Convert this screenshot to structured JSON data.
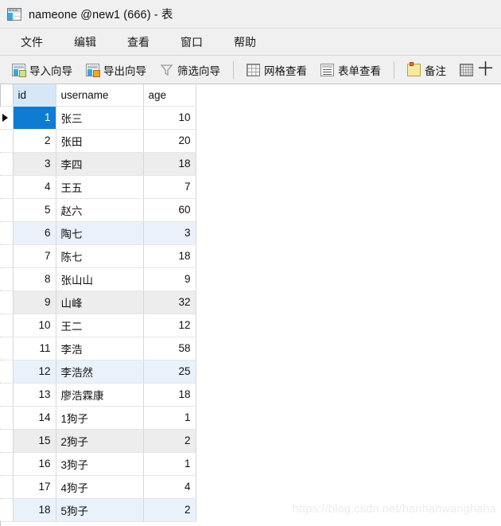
{
  "window": {
    "title": "nameone @new1 (666) - 表",
    "icon": "table-icon"
  },
  "menubar": {
    "items": [
      {
        "label": "文件",
        "name": "menu-file"
      },
      {
        "label": "编辑",
        "name": "menu-edit"
      },
      {
        "label": "查看",
        "name": "menu-view"
      },
      {
        "label": "窗口",
        "name": "menu-window"
      },
      {
        "label": "帮助",
        "name": "menu-help"
      }
    ]
  },
  "toolbar": {
    "groups": [
      {
        "buttons": [
          {
            "label": "导入向导",
            "icon": "import-wizard-icon"
          },
          {
            "label": "导出向导",
            "icon": "export-wizard-icon"
          },
          {
            "label": "筛选向导",
            "icon": "filter-wizard-icon"
          }
        ]
      },
      {
        "buttons": [
          {
            "label": "网格查看",
            "icon": "grid-view-icon"
          },
          {
            "label": "表单查看",
            "icon": "form-view-icon"
          }
        ]
      },
      {
        "buttons": [
          {
            "label": "备注",
            "icon": "memo-icon"
          },
          {
            "label": "十",
            "icon": "add-record-icon"
          }
        ]
      }
    ]
  },
  "grid": {
    "columns": [
      "id",
      "username",
      "age"
    ],
    "selected_cell": {
      "row": 1,
      "column": "id"
    },
    "rows": [
      {
        "id": "1",
        "username": "张三",
        "age": "10"
      },
      {
        "id": "2",
        "username": "张田",
        "age": "20"
      },
      {
        "id": "3",
        "username": "李四",
        "age": "18"
      },
      {
        "id": "4",
        "username": "王五",
        "age": "7"
      },
      {
        "id": "5",
        "username": "赵六",
        "age": "60"
      },
      {
        "id": "6",
        "username": "陶七",
        "age": "3"
      },
      {
        "id": "7",
        "username": "陈七",
        "age": "18"
      },
      {
        "id": "8",
        "username": "张山山",
        "age": "9"
      },
      {
        "id": "9",
        "username": "山峰",
        "age": "32"
      },
      {
        "id": "10",
        "username": "王二",
        "age": "12"
      },
      {
        "id": "11",
        "username": "李浩",
        "age": "58"
      },
      {
        "id": "12",
        "username": "李浩然",
        "age": "25"
      },
      {
        "id": "13",
        "username": "廖浩霖康",
        "age": "18"
      },
      {
        "id": "14",
        "username": "1狗子",
        "age": "1"
      },
      {
        "id": "15",
        "username": "2狗子",
        "age": "2"
      },
      {
        "id": "16",
        "username": "3狗子",
        "age": "1"
      },
      {
        "id": "17",
        "username": "4狗子",
        "age": "4"
      },
      {
        "id": "18",
        "username": "5狗子",
        "age": "2"
      }
    ]
  },
  "watermark": {
    "text": "https://blog.csdn.net/hanhanwanghaha"
  },
  "colors": {
    "selection": "#0f7cd4",
    "header_selected": "#d6e8f7",
    "row_alt_gray": "#ededed",
    "row_alt_blue": "#e9f2fb",
    "chrome": "#f0f0f0"
  }
}
